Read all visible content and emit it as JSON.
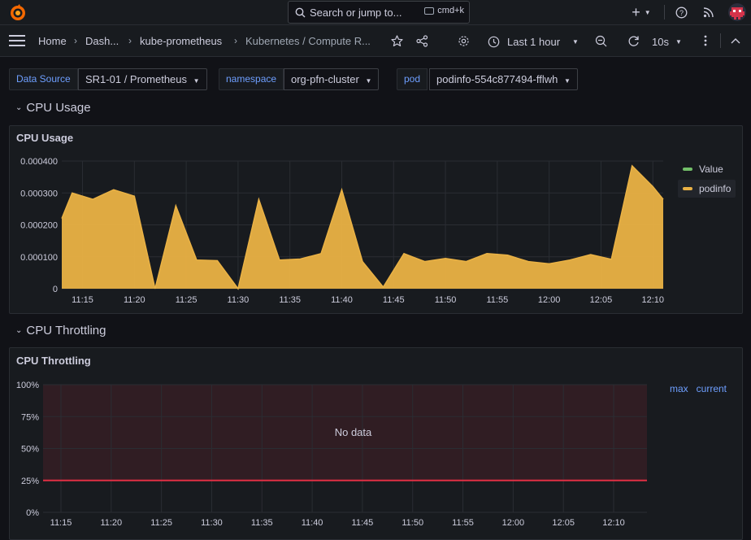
{
  "topbar": {
    "search_placeholder": "Search or jump to...",
    "search_shortcut": "cmd+k",
    "add_icon": "plus-icon",
    "help_icon": "help-icon",
    "news_icon": "rss-icon",
    "avatar_icon": "avatar-icon"
  },
  "navbar": {
    "breadcrumbs": [
      "Home",
      "Dash...",
      "kube-prometheus",
      "Kubernetes / Compute R..."
    ],
    "time_range": "Last 1 hour",
    "refresh_interval": "10s"
  },
  "variables": [
    {
      "label": "Data Source",
      "value": "SR1-01 / Prometheus"
    },
    {
      "label": "namespace",
      "value": "org-pfn-cluster"
    },
    {
      "label": "pod",
      "value": "podinfo-554c877494-fflwh"
    }
  ],
  "rows": {
    "cpu_usage": "CPU Usage",
    "cpu_throttling": "CPU Throttling"
  },
  "colors": {
    "accent": "#6e9fff",
    "series_podinfo": "#eab245",
    "series_value": "#73bf69",
    "threshold_red": "#e02f44"
  },
  "panels": {
    "cpu_usage": {
      "title": "CPU Usage",
      "legend": [
        {
          "name": "Value",
          "color": "#73bf69"
        },
        {
          "name": "podinfo",
          "color": "#eab245"
        }
      ]
    },
    "cpu_throttling": {
      "title": "CPU Throttling",
      "no_data": "No data",
      "legend_headers": [
        "max",
        "current"
      ]
    }
  },
  "chart_data": [
    {
      "type": "area",
      "title": "CPU Usage",
      "x": [
        "11:13",
        "11:14",
        "11:16",
        "11:18",
        "11:20",
        "11:22",
        "11:24",
        "11:26",
        "11:28",
        "11:30",
        "11:32",
        "11:34",
        "11:36",
        "11:38",
        "11:40",
        "11:42",
        "11:44",
        "11:46",
        "11:48",
        "11:50",
        "11:52",
        "11:54",
        "11:56",
        "11:58",
        "12:00",
        "12:02",
        "12:04",
        "12:06",
        "12:08",
        "12:10",
        "12:11"
      ],
      "xticks": [
        "11:15",
        "11:20",
        "11:25",
        "11:30",
        "11:35",
        "11:40",
        "11:45",
        "11:50",
        "11:55",
        "12:00",
        "12:05",
        "12:10"
      ],
      "yticks": [
        "0",
        "0.000100",
        "0.000200",
        "0.000300",
        "0.000400"
      ],
      "ylim": [
        0,
        0.0004
      ],
      "grid": true,
      "legend_position": "right",
      "series": [
        {
          "name": "podinfo",
          "values": [
            0.00022,
            0.0003,
            0.00028,
            0.00031,
            0.00029,
            0.0,
            0.00026,
            9e-05,
            8.8e-05,
            0.0,
            0.00028,
            9e-05,
            9.3e-05,
            0.00011,
            0.00031,
            8.5e-05,
            5e-06,
            0.00011,
            8.5e-05,
            9.5e-05,
            8.5e-05,
            0.00011,
            0.000105,
            8.5e-05,
            7.8e-05,
            9e-05,
            0.000107,
            9.2e-05,
            0.000385,
            0.00032,
            0.00028
          ]
        },
        {
          "name": "Value",
          "values": []
        }
      ]
    },
    {
      "type": "line",
      "title": "CPU Throttling",
      "xticks": [
        "11:15",
        "11:20",
        "11:25",
        "11:30",
        "11:35",
        "11:40",
        "11:45",
        "11:50",
        "11:55",
        "12:00",
        "12:05",
        "12:10"
      ],
      "yticks": [
        "0%",
        "25%",
        "50%",
        "75%",
        "100%"
      ],
      "ylim": [
        0,
        100
      ],
      "threshold": 25,
      "grid": true,
      "series": []
    }
  ]
}
